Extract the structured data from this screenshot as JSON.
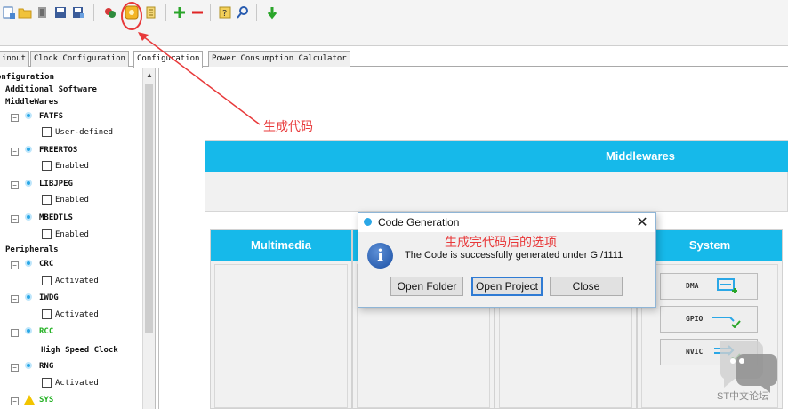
{
  "toolbar": {
    "icons": [
      "new-project-icon",
      "open-folder-icon",
      "copy-icon",
      "save-icon",
      "save-as-icon",
      "pin-icon",
      "generate-code-icon",
      "report-icon",
      "zoom-in-icon",
      "zoom-out-icon",
      "help-icon",
      "search-icon",
      "download-icon"
    ]
  },
  "tabs": [
    {
      "label": "inout"
    },
    {
      "label": "Clock Configuration"
    },
    {
      "label": "Configuration"
    },
    {
      "label": "Power Consumption Calculator"
    }
  ],
  "tree": {
    "root": "onfiguration",
    "additional": "Additional Software",
    "middlewares": "MiddleWares",
    "fatfs": "FATFS",
    "user_defined": "User-defined",
    "freertos": "FREERTOS",
    "enabled": "Enabled",
    "libjpeg": "LIBJPEG",
    "mbedtls": "MBEDTLS",
    "peripherals": "Peripherals",
    "crc": "CRC",
    "activated": "Activated",
    "iwdg": "IWDG",
    "rcc": "RCC",
    "hse": "High Speed Clock",
    "rng": "RNG",
    "sys": "SYS"
  },
  "canvas": {
    "middlewares_header": "Middlewares",
    "multimedia_header": "Multimedia",
    "system_header": "System",
    "dma_label": "DMA",
    "gpio_label": "GPIO",
    "nvic_label": "NVIC"
  },
  "dialog": {
    "title": "Code Generation",
    "close": "✕",
    "message": "The Code is successfully generated under G:/1111",
    "open_folder": "Open Folder",
    "open_project": "Open Project",
    "close_button": "Close"
  },
  "annotations": {
    "generate_code": "生成代码",
    "after_generate": "生成完代码后的选项"
  },
  "watermark": {
    "text": "ST中文论坛"
  },
  "colors": {
    "accent_header": "#16b9ea",
    "annotation": "#e8393a"
  }
}
